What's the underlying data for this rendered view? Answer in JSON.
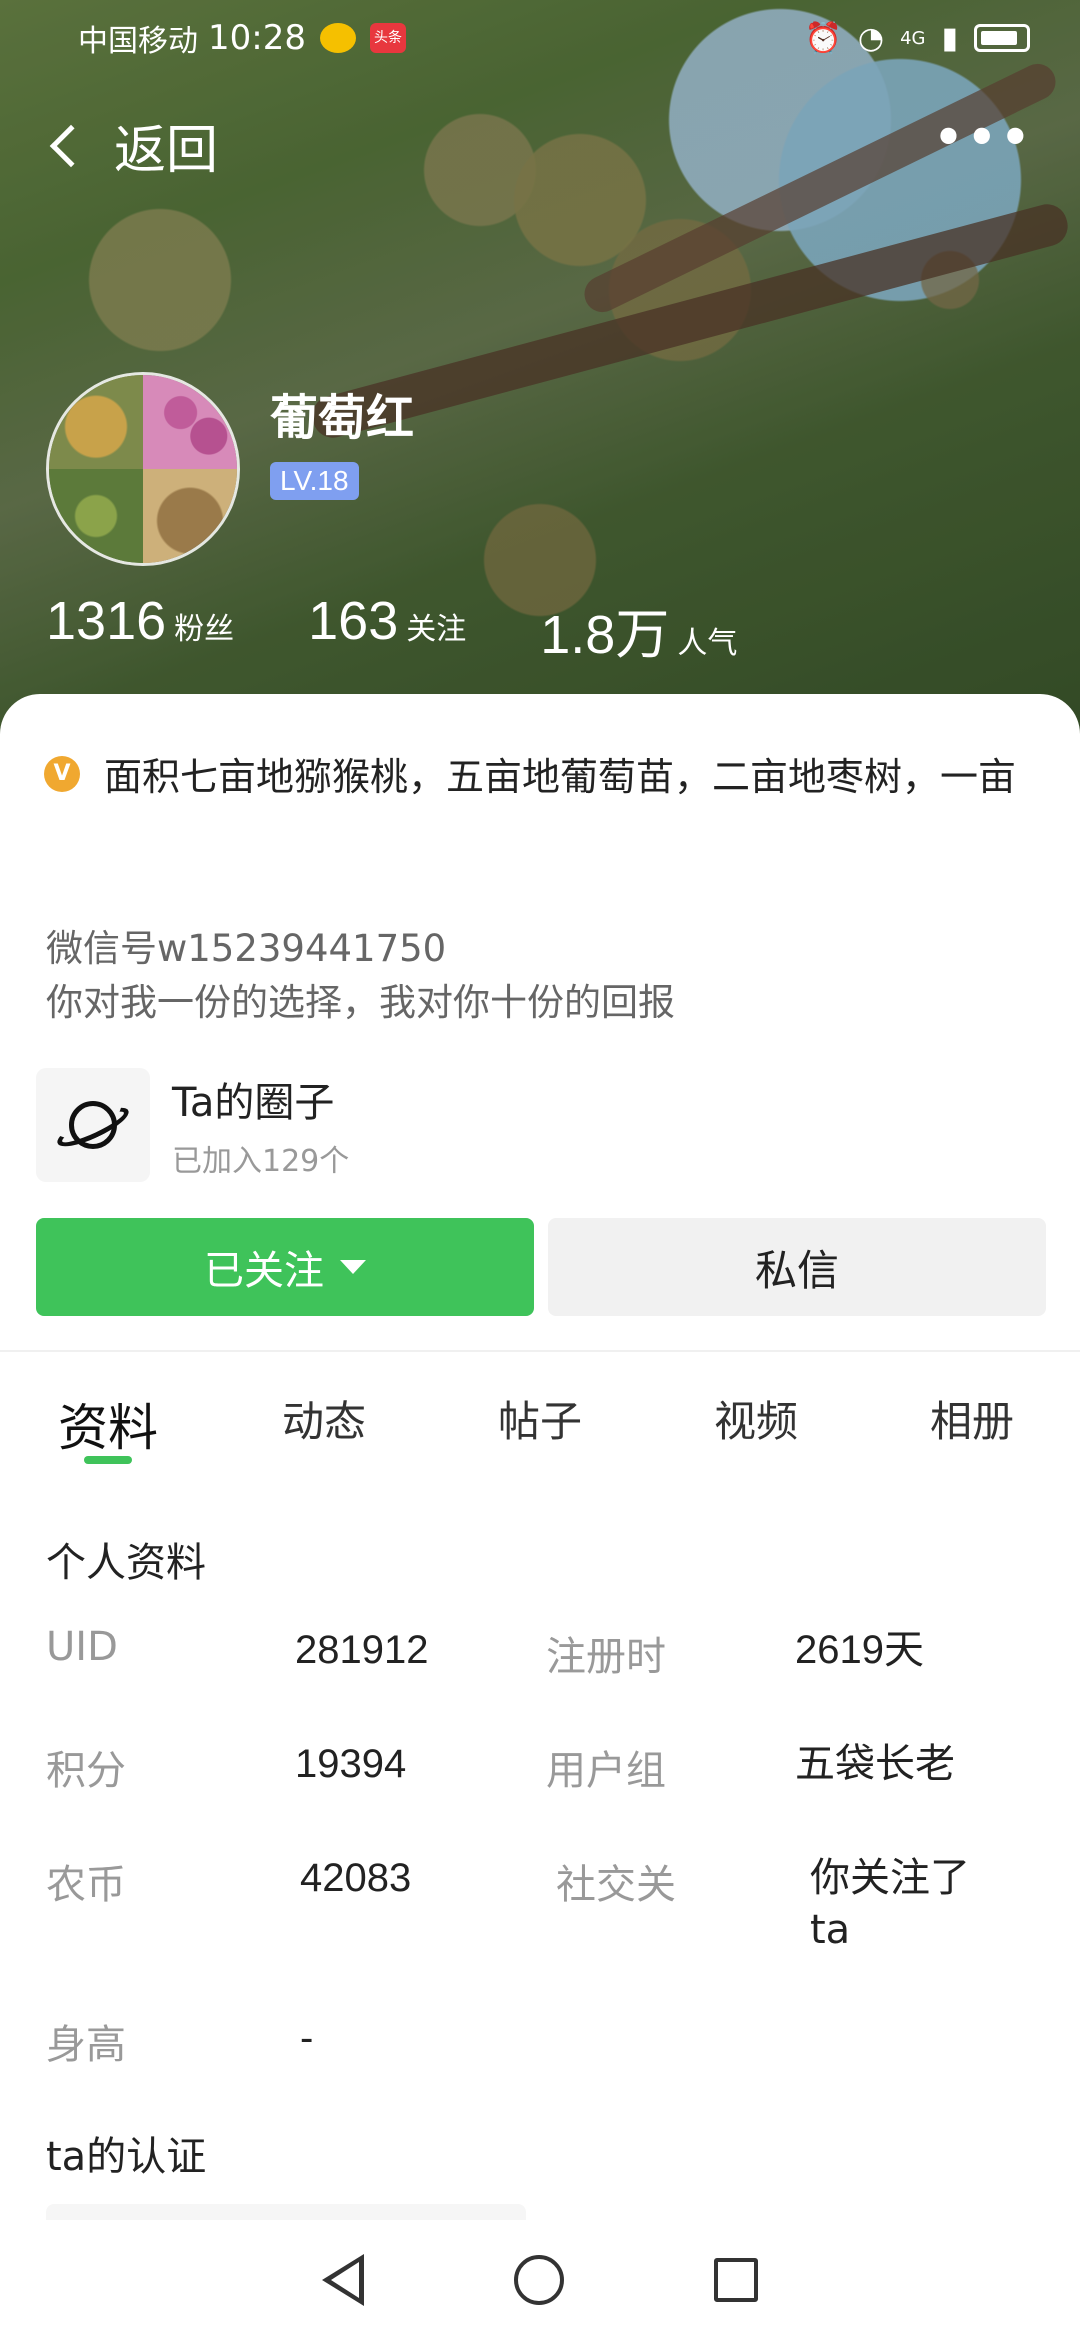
{
  "status_bar": {
    "carrier": "中国移动",
    "time": "10:28",
    "toutiao_badge": "头条",
    "network": "4G"
  },
  "nav": {
    "back_label": "返回",
    "more_label": "•••"
  },
  "profile": {
    "name": "葡萄红",
    "level": "LV.18",
    "stats": [
      {
        "num": "1316",
        "label": "粉丝"
      },
      {
        "num": "163",
        "label": "关注"
      },
      {
        "num": "1.8万",
        "label": "人气"
      }
    ]
  },
  "intro": {
    "verify_glyph": "V",
    "text": "面积七亩地猕猴桃，五亩地葡萄苗，二亩地枣树，一亩"
  },
  "bio": {
    "line1": "微信号w15239441750",
    "line2": "你对我一份的选择，我对你十份的回报"
  },
  "circle": {
    "title": "Ta的圈子",
    "subtitle": "已加入129个"
  },
  "actions": {
    "follow_label": "已关注",
    "message_label": "私信"
  },
  "tabs": [
    {
      "label": "资料",
      "active": true
    },
    {
      "label": "动态",
      "active": false
    },
    {
      "label": "帖子",
      "active": false
    },
    {
      "label": "视频",
      "active": false
    },
    {
      "label": "相册",
      "active": false
    }
  ],
  "personal_info": {
    "title": "个人资料",
    "rows": [
      {
        "k1": "UID",
        "v1": "281912",
        "k2": "注册时",
        "v2": "2619天"
      },
      {
        "k1": "积分",
        "v1": "19394",
        "k2": "用户组",
        "v2": "五袋长老"
      },
      {
        "k1": "农币",
        "v1": "42083",
        "k2": "社交关",
        "v2": "你关注了ta"
      },
      {
        "k1": "身高",
        "v1": "-",
        "k2": "",
        "v2": ""
      }
    ]
  },
  "certification": {
    "title": "ta的认证"
  },
  "colors": {
    "accent_green": "#3fc35a",
    "level_badge": "#7f9ff0",
    "verify_orange": "#f0a830"
  }
}
